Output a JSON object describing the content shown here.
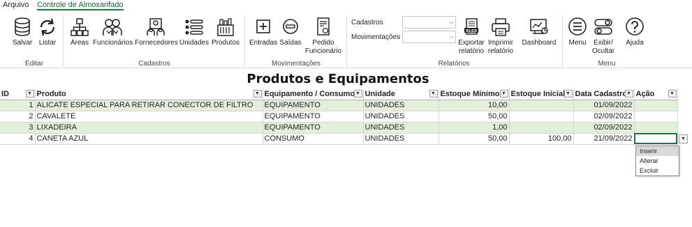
{
  "menubar": {
    "file": "Arquivo",
    "tab": "Controle de Almoxarifado"
  },
  "ribbon": {
    "editar": {
      "label": "Editar",
      "salvar": "Salvar",
      "listar": "Listar"
    },
    "cadastros": {
      "label": "Cadastros",
      "areas": "Áreas",
      "funcionarios": "Funcionários",
      "fornecedores": "Fornecedores",
      "unidades": "Unidades",
      "produtos": "Produtos"
    },
    "movimentacoes": {
      "label": "Movimentações",
      "entradas": "Entradas",
      "saidas": "Saídas",
      "pedido_1": "Pedido",
      "pedido_2": "Funcionário"
    },
    "relatorios": {
      "label": "Relatórios",
      "cadastros_label": "Cadastros",
      "movimentacoes_label": "Movimentações",
      "exportar_1": "Exportar",
      "exportar_2": "relatório",
      "imprimir_1": "Imprimir",
      "imprimir_2": "relatório",
      "dashboard": "Dashboard"
    },
    "menu": {
      "label": "Menu",
      "menu": "Menu",
      "exibir_1": "Exibir/",
      "exibir_2": "Ocultar",
      "ajuda": "Ajuda"
    }
  },
  "sheet": {
    "title": "Produtos e Equipamentos",
    "headers": [
      "ID",
      "Produto",
      "Equipamento / Consumo",
      "Unidade",
      "Estoque Mínimo",
      "Estoque Inicial",
      "Data Cadastro",
      "Ação"
    ],
    "rows": [
      {
        "id": "1",
        "produto": "ALICATE ESPECIAL PARA RETIRAR CONECTOR DE FILTRO",
        "tipo": "EQUIPAMENTO",
        "unidade": "UNIDADES",
        "min": "10,00",
        "inicial": "",
        "data": "01/09/2022",
        "acao": ""
      },
      {
        "id": "2",
        "produto": "CAVALETE",
        "tipo": "EQUIPAMENTO",
        "unidade": "UNIDADES",
        "min": "50,00",
        "inicial": "",
        "data": "02/09/2022",
        "acao": ""
      },
      {
        "id": "3",
        "produto": "LIXADEIRA",
        "tipo": "EQUIPAMENTO",
        "unidade": "UNIDADES",
        "min": "1,00",
        "inicial": "",
        "data": "02/09/2022",
        "acao": ""
      },
      {
        "id": "4",
        "produto": "CANETA AZUL",
        "tipo": "CONSUMO",
        "unidade": "UNIDADES",
        "min": "50,00",
        "inicial": "100,00",
        "data": "21/09/2022",
        "acao": ""
      }
    ],
    "dropdown_options": [
      "Inserir",
      "Alterar",
      "Excluir"
    ]
  },
  "colors": {
    "accent": "#217346",
    "band": "#e2efda"
  }
}
